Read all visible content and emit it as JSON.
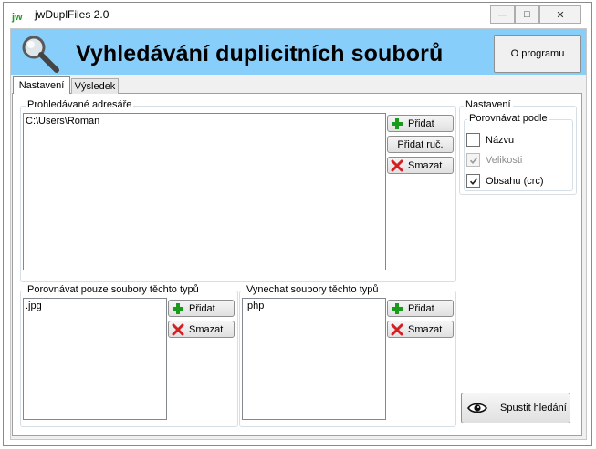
{
  "window": {
    "app_icon_text": "jw",
    "title": "jwDuplFiles 2.0",
    "minimize_glyph": "—",
    "maximize_glyph": "□",
    "close_glyph": "✕"
  },
  "header": {
    "title": "Vyhledávání duplicitních souborů",
    "about_button": "O programu"
  },
  "tabs": [
    {
      "label": "Nastavení"
    },
    {
      "label": "Výsledek"
    }
  ],
  "directories": {
    "group_label": "Prohledávané adresáře",
    "items": [
      "C:\\Users\\Roman"
    ],
    "add_button": "Přidat",
    "add_manual_button": "Přidat ruč.",
    "delete_button": "Smazat"
  },
  "settings": {
    "group_label": "Nastavení",
    "compare_label": "Porovnávat podle",
    "options": [
      {
        "label": "Názvu",
        "checked": false,
        "enabled": true
      },
      {
        "label": "Velikosti",
        "checked": true,
        "enabled": false
      },
      {
        "label": "Obsahu (crc)",
        "checked": true,
        "enabled": true
      }
    ]
  },
  "include_types": {
    "group_label": "Porovnávat pouze soubory těchto typů",
    "items": [
      ".jpg"
    ],
    "add_button": "Přidat",
    "delete_button": "Smazat"
  },
  "exclude_types": {
    "group_label": "Vynechat soubory těchto typů",
    "items": [
      ".php"
    ],
    "add_button": "Přidat",
    "delete_button": "Smazat"
  },
  "start_button": "Spustit hledání",
  "colors": {
    "banner": "#87cefa",
    "add_icon": "#1a9a1a",
    "delete_icon": "#d42020"
  }
}
